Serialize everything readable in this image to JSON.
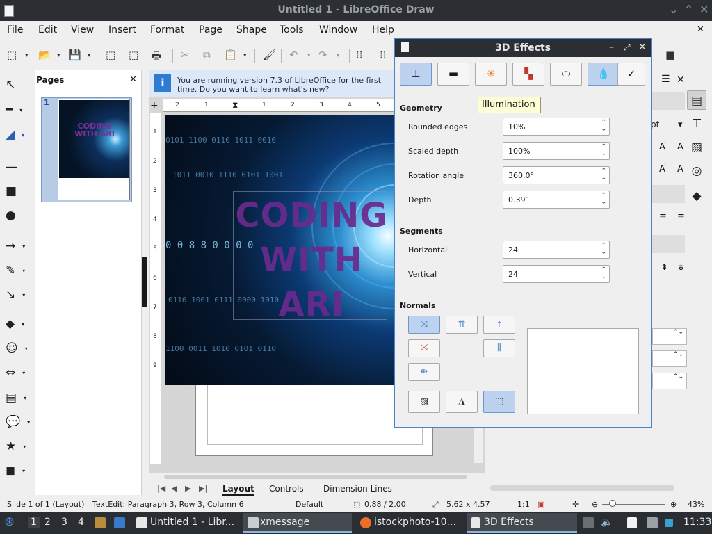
{
  "window": {
    "title": "Untitled 1 - LibreOffice Draw"
  },
  "menubar": {
    "items": [
      "File",
      "Edit",
      "View",
      "Insert",
      "Format",
      "Page",
      "Shape",
      "Tools",
      "Window",
      "Help"
    ]
  },
  "icons": {
    "title_minimize": "⌄",
    "title_maximize": "⌃",
    "title_close": "✕",
    "doc_close": "✕",
    "pages_close": "✕",
    "sidebar_close": "✕",
    "sidebar_menu": "☰",
    "info": "i",
    "dd": "▾",
    "toolbar": [
      "⬚",
      "▾",
      "📂",
      "▾",
      "💾",
      "▾",
      "⬚",
      "⬚",
      "🖶",
      "✂",
      "⧉",
      "📋",
      "▾",
      "🖌",
      "↶",
      "▾",
      "↷",
      "▾",
      "⁞⁞",
      "⁞⁞",
      "■"
    ],
    "left_tools": [
      "↖",
      "━",
      "▾",
      "◢",
      "▾",
      "—",
      "■",
      "●",
      "→",
      "▾",
      "✎",
      "▾",
      "↘",
      "▾",
      "◆",
      "▾",
      "☺",
      "▾",
      "⇔",
      "▾",
      "▤",
      "▾",
      "💬",
      "▾",
      "★",
      "▾",
      "◼",
      "▾"
    ],
    "tab_nav": [
      "|◀",
      "◀",
      "▶",
      "▶|"
    ],
    "spin_arrows": "⌃⌄",
    "sidebar_deck": [
      "▤",
      "⊤",
      "▨",
      "◎",
      "◆"
    ],
    "sidebar_symbols": [
      "A͘",
      "A",
      "A͘",
      "A",
      "≡",
      "≡",
      "⇞",
      "⇟"
    ],
    "dialog_tabs": [
      "⊥",
      "▬",
      "☀",
      "▚",
      "⬭",
      "💧",
      "✓"
    ],
    "normals": [
      "⤨",
      "⇈",
      "⤒",
      "⤩",
      "⫼",
      "⇹",
      "▨",
      "◮",
      "⬚"
    ],
    "status": [
      "⬚",
      "⤢",
      "↔",
      "✛",
      "⊖",
      "⊕"
    ],
    "taskbar": [
      "⊛",
      "🗔",
      "🗔",
      "🦊",
      "🔈",
      "🗎",
      "🗔",
      "⇅",
      "🔔"
    ]
  },
  "pages_panel": {
    "title": "Pages",
    "slide_number": "1",
    "thumb_text": "CODING WITH ARI"
  },
  "infobar": {
    "message": "You are running version 7.3 of LibreOffice for the first time. Do you want to learn what's new?"
  },
  "canvas": {
    "art_text": "CODING WITH ARI"
  },
  "ruler": {
    "h": [
      "2",
      "1",
      "1",
      "2",
      "3",
      "4",
      "5"
    ],
    "v": [
      "1",
      "2",
      "3",
      "4",
      "5",
      "6",
      "7",
      "8",
      "9"
    ]
  },
  "tabs": {
    "items": [
      "Layout",
      "Controls",
      "Dimension Lines"
    ],
    "active": "Layout"
  },
  "sidebar": {
    "unit": "pt"
  },
  "dialog": {
    "title": "3D Effects",
    "tooltip": "Illumination",
    "geometry": {
      "section": "Geometry",
      "fields": [
        {
          "label": "Rounded edges",
          "value": "10%"
        },
        {
          "label": "Scaled depth",
          "value": "100%"
        },
        {
          "label": "Rotation angle",
          "value": "360.0°"
        },
        {
          "label": "Depth",
          "value": "0.39″"
        }
      ]
    },
    "segments": {
      "section": "Segments",
      "fields": [
        {
          "label": "Horizontal",
          "value": "24"
        },
        {
          "label": "Vertical",
          "value": "24"
        }
      ]
    },
    "normals": {
      "section": "Normals"
    }
  },
  "statusbar": {
    "slide": "Slide 1 of 1 (Layout)",
    "edit": "TextEdit: Paragraph 3, Row 3, Column 6",
    "layout": "Default",
    "pos": "0.88 / 2.00",
    "size": "5.62 x 4.57",
    "scale": "1:1",
    "zoom": "43%"
  },
  "taskbar": {
    "workspaces": [
      "1",
      "2",
      "3",
      "4"
    ],
    "items": [
      "Untitled 1 - Libr...",
      "xmessage",
      "istockphoto-10...",
      "3D Effects"
    ],
    "clock": "11:33"
  },
  "colors": {
    "accent": "#4a84c8",
    "selected_button": "#bcd2ee",
    "art_text": "#6a2a8e"
  }
}
